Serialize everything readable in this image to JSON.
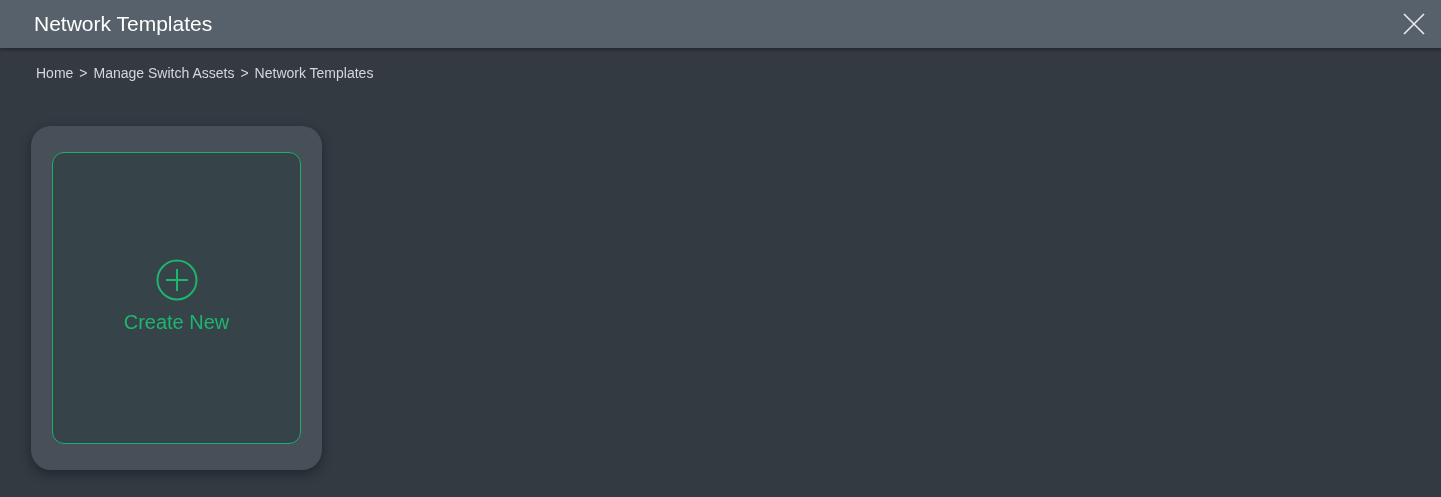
{
  "window": {
    "title": "Network Templates"
  },
  "breadcrumb": {
    "items": [
      "Home",
      "Manage Switch Assets",
      "Network Templates"
    ],
    "separator": ">"
  },
  "create_card": {
    "label": "Create New"
  }
}
